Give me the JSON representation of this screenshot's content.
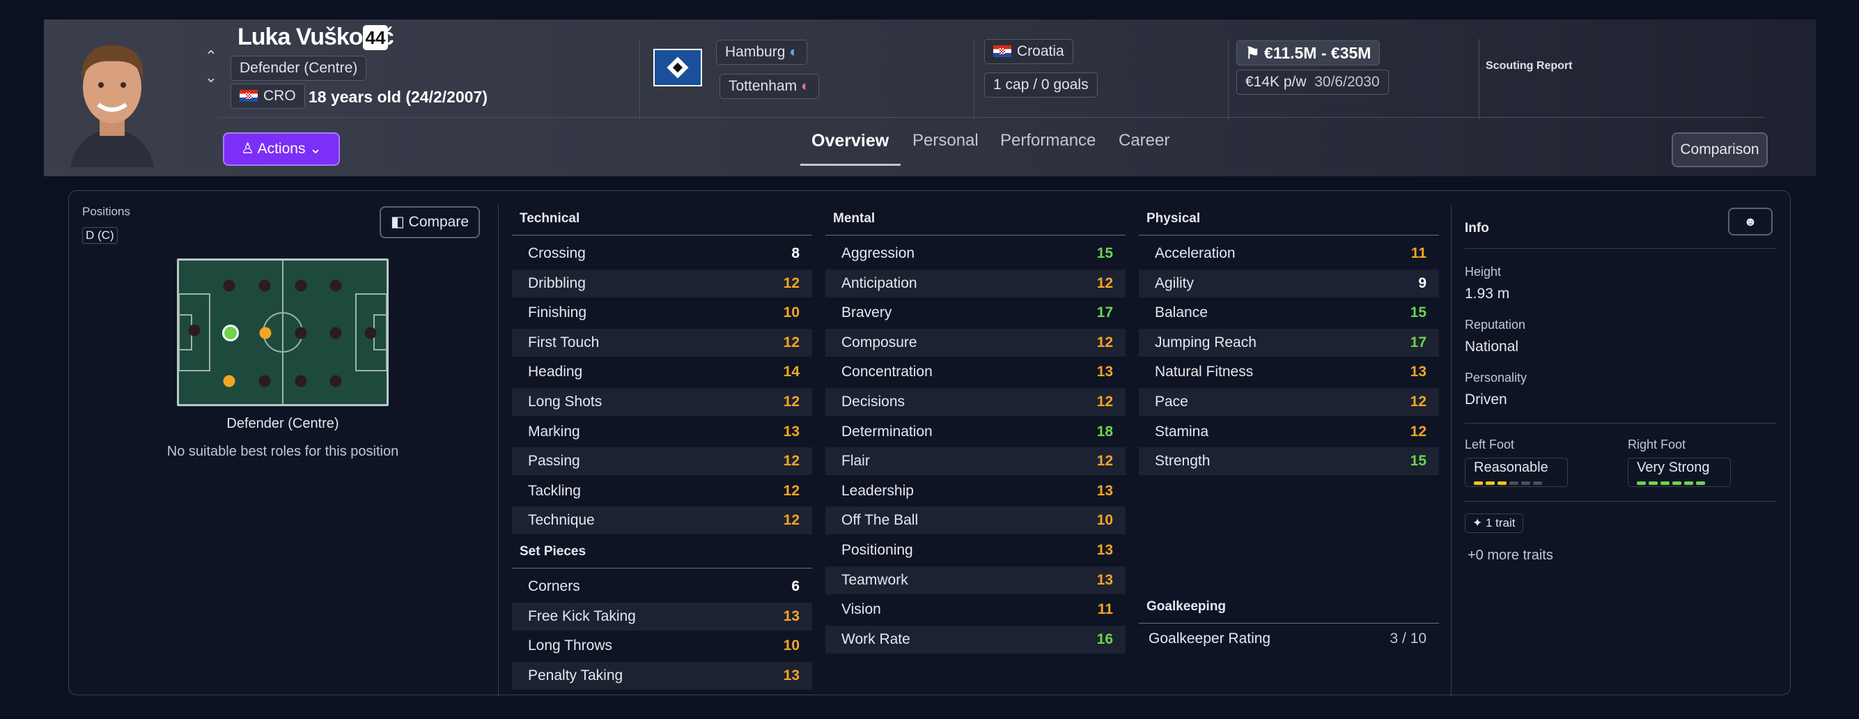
{
  "player": {
    "name": "Luka Vuškovič",
    "number": "44",
    "position": "Defender (Centre)",
    "nation_code": "CRO",
    "age": "18 years old (24/2/2007)"
  },
  "clubs": {
    "club": "Hamburg",
    "loan_from": "Tottenham"
  },
  "nation": {
    "name": "Croatia",
    "caps": "1 cap / 0 goals"
  },
  "value": {
    "range": "€11.5M - €35M",
    "wage": "€14K p/w",
    "contract": "30/6/2030"
  },
  "scouting_report": "Scouting Report",
  "actions_label": "Actions",
  "tabs": [
    "Overview",
    "Personal",
    "Performance",
    "Career"
  ],
  "comparison_label": "Comparison",
  "positions": {
    "title": "Positions",
    "code": "D (C)",
    "compare_label": "Compare",
    "role_name": "Defender (Centre)",
    "note": "No suitable best roles for this position"
  },
  "technical": {
    "title": "Technical",
    "attrs": [
      [
        "Crossing",
        "8"
      ],
      [
        "Dribbling",
        "12"
      ],
      [
        "Finishing",
        "10"
      ],
      [
        "First Touch",
        "12"
      ],
      [
        "Heading",
        "14"
      ],
      [
        "Long Shots",
        "12"
      ],
      [
        "Marking",
        "13"
      ],
      [
        "Passing",
        "12"
      ],
      [
        "Tackling",
        "12"
      ],
      [
        "Technique",
        "12"
      ]
    ]
  },
  "set_pieces": {
    "title": "Set Pieces",
    "attrs": [
      [
        "Corners",
        "6"
      ],
      [
        "Free Kick Taking",
        "13"
      ],
      [
        "Long Throws",
        "10"
      ],
      [
        "Penalty Taking",
        "13"
      ]
    ]
  },
  "mental": {
    "title": "Mental",
    "attrs": [
      [
        "Aggression",
        "15"
      ],
      [
        "Anticipation",
        "12"
      ],
      [
        "Bravery",
        "17"
      ],
      [
        "Composure",
        "12"
      ],
      [
        "Concentration",
        "13"
      ],
      [
        "Decisions",
        "12"
      ],
      [
        "Determination",
        "18"
      ],
      [
        "Flair",
        "12"
      ],
      [
        "Leadership",
        "13"
      ],
      [
        "Off The Ball",
        "10"
      ],
      [
        "Positioning",
        "13"
      ],
      [
        "Teamwork",
        "13"
      ],
      [
        "Vision",
        "11"
      ],
      [
        "Work Rate",
        "16"
      ]
    ]
  },
  "physical": {
    "title": "Physical",
    "attrs": [
      [
        "Acceleration",
        "11"
      ],
      [
        "Agility",
        "9"
      ],
      [
        "Balance",
        "15"
      ],
      [
        "Jumping Reach",
        "17"
      ],
      [
        "Natural Fitness",
        "13"
      ],
      [
        "Pace",
        "12"
      ],
      [
        "Stamina",
        "12"
      ],
      [
        "Strength",
        "15"
      ]
    ]
  },
  "goalkeeping": {
    "title": "Goalkeeping",
    "label": "Goalkeeper Rating",
    "value": "3 / 10"
  },
  "info": {
    "title": "Info",
    "height_label": "Height",
    "height": "1.93 m",
    "reputation_label": "Reputation",
    "reputation": "National",
    "personality_label": "Personality",
    "personality": "Driven",
    "left_foot_label": "Left Foot",
    "left_foot": "Reasonable",
    "left_foot_level": 3,
    "right_foot_label": "Right Foot",
    "right_foot": "Very Strong",
    "right_foot_level": 6,
    "traits": "1 trait",
    "more_traits": "+0 more traits"
  },
  "colors": {
    "accent": "#7b2ff7",
    "high": "#6dd44c",
    "mid": "#f5a524",
    "low": "#ffffff"
  }
}
